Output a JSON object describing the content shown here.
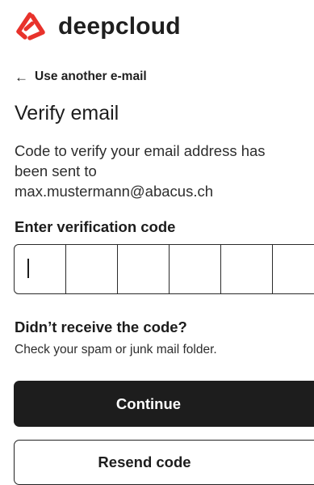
{
  "brand": {
    "name": "deepcloud",
    "logo_icon": "deepcloud-logo-icon",
    "accent_color": "#e8322b"
  },
  "nav": {
    "back_arrow": "←",
    "back_label": "Use another e-mail"
  },
  "page": {
    "title": "Verify email",
    "description_line1": "Code to verify your email address has",
    "description_line2": "been sent to",
    "email": "max.mustermann@abacus.ch"
  },
  "code": {
    "label": "Enter verification code",
    "digits": [
      "",
      "",
      "",
      "",
      "",
      ""
    ]
  },
  "resend": {
    "title": "Didn’t receive the code?",
    "hint": "Check your spam or junk mail folder."
  },
  "actions": {
    "continue_label": "Continue",
    "resend_label": "Resend code"
  }
}
